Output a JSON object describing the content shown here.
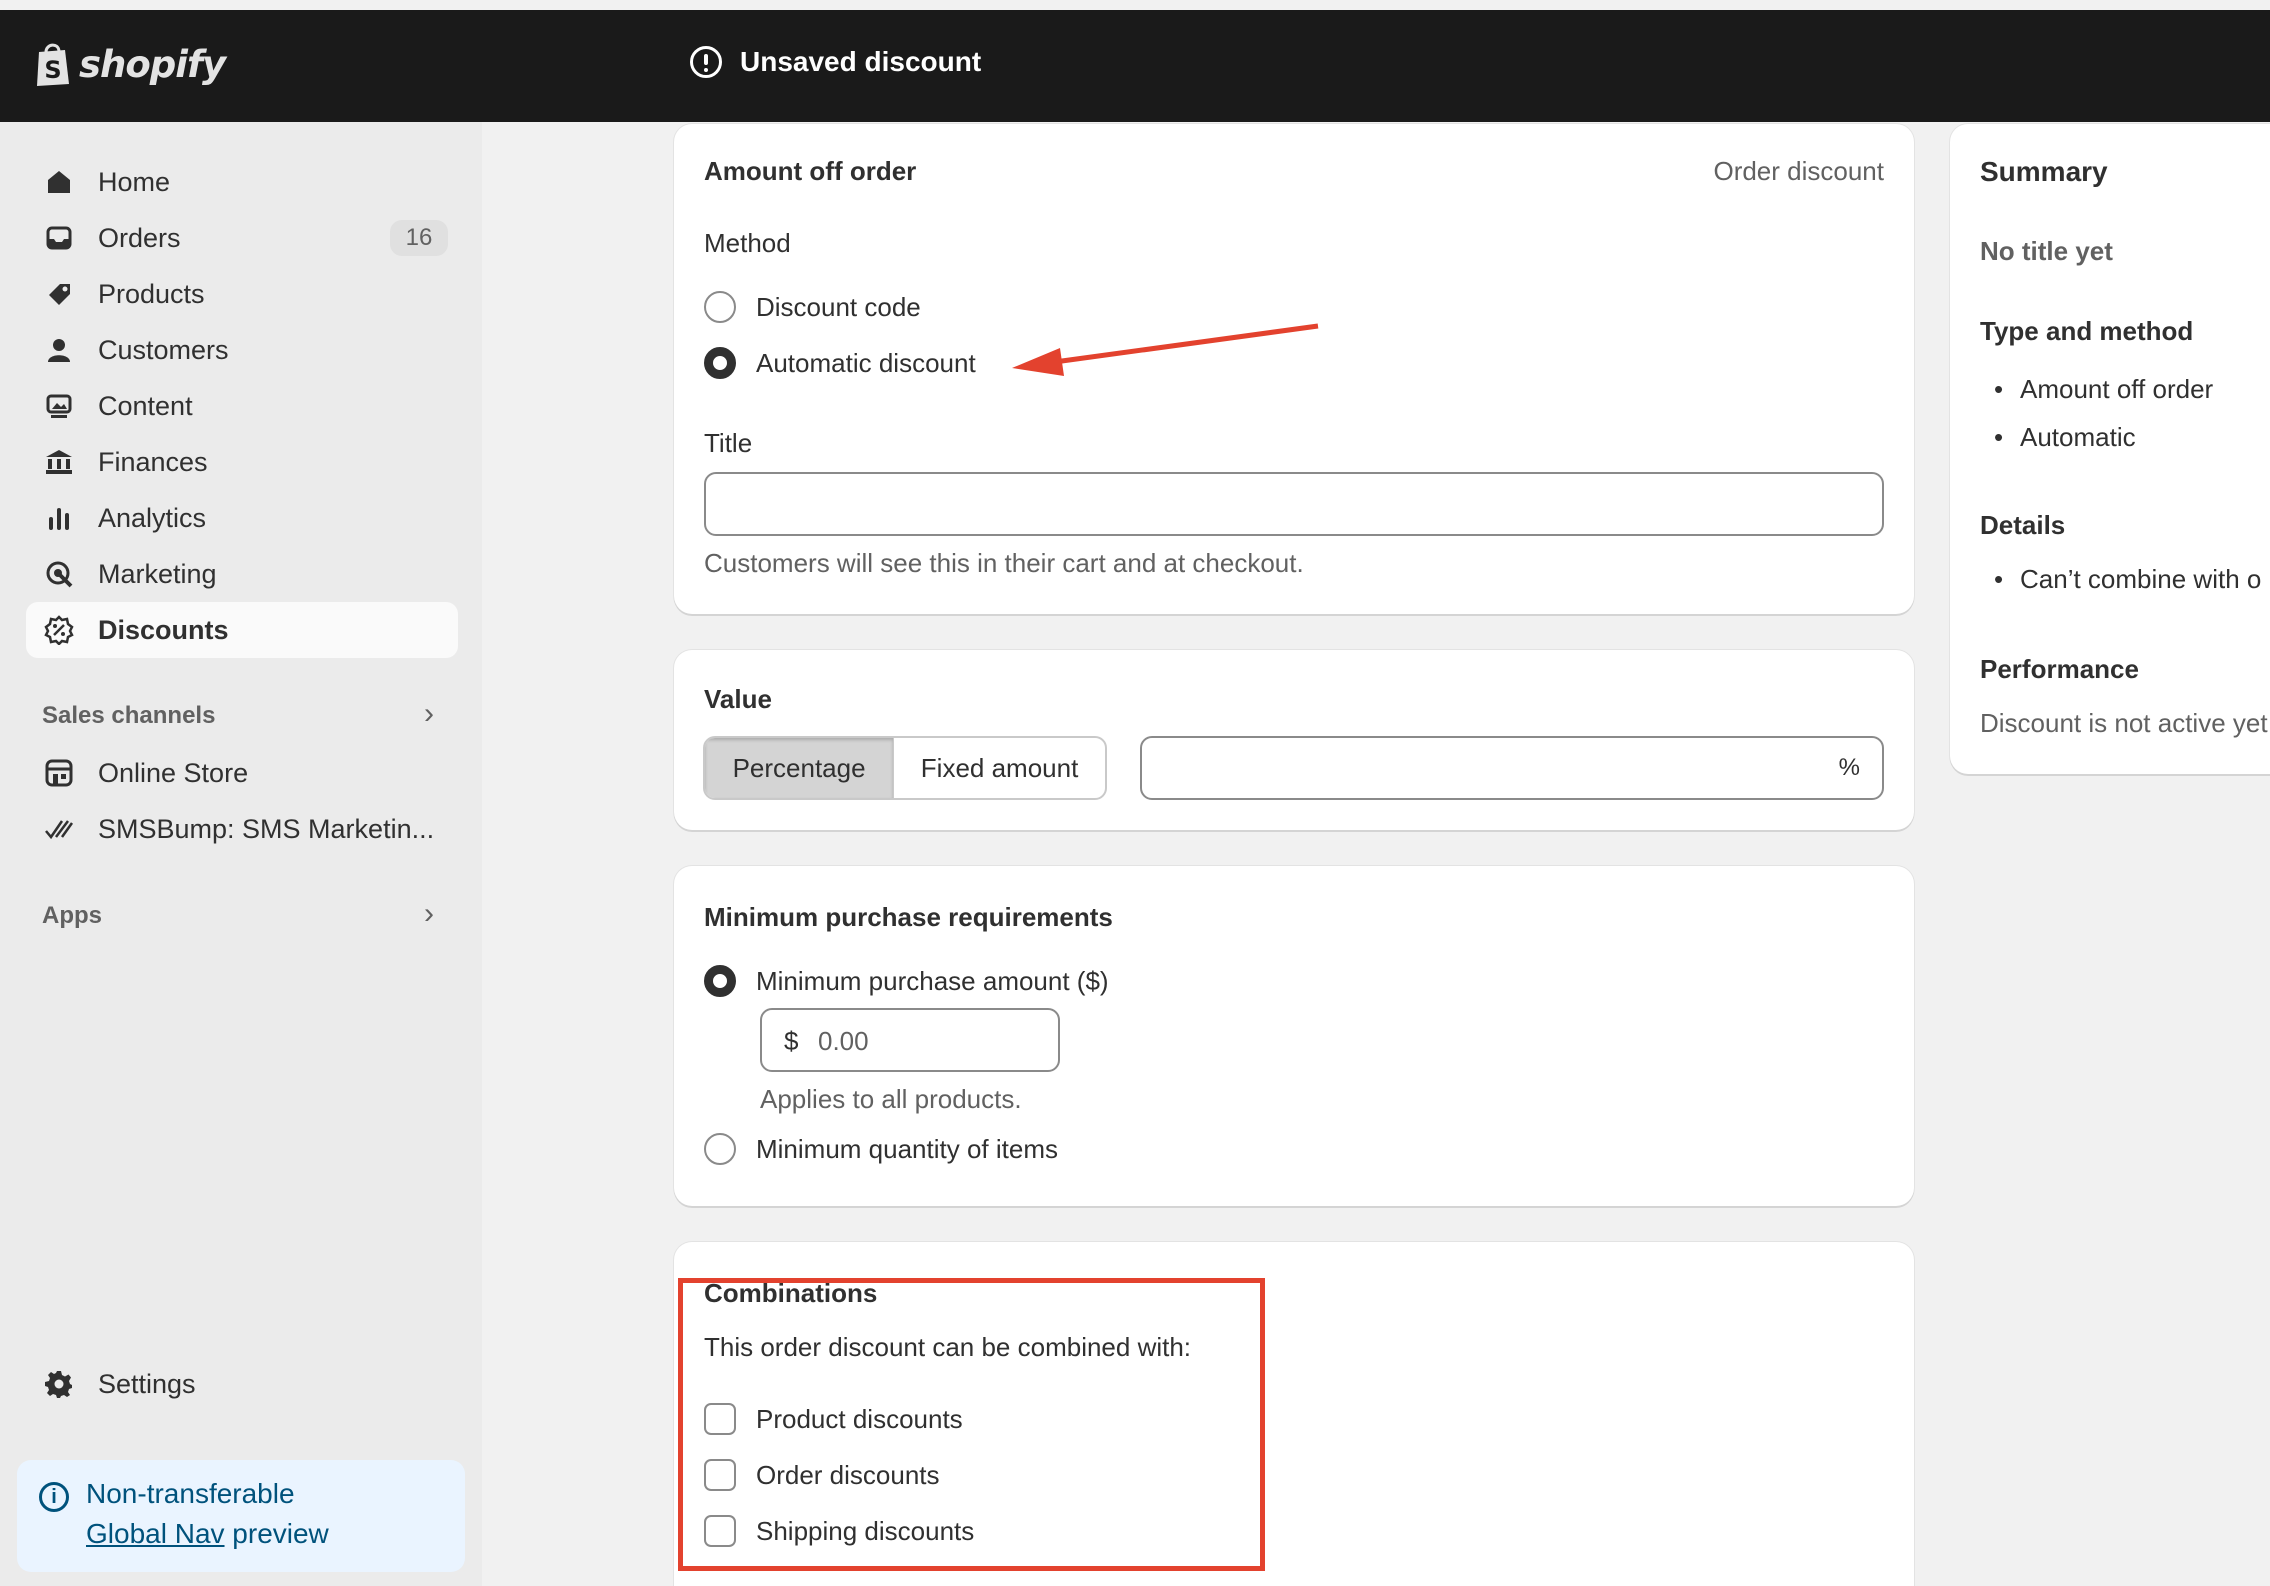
{
  "topbar": {
    "brand": "shopify",
    "status_title": "Unsaved discount"
  },
  "sidebar": {
    "items": [
      {
        "label": "Home",
        "icon": "home-icon"
      },
      {
        "label": "Orders",
        "icon": "inbox-icon",
        "badge": "16"
      },
      {
        "label": "Products",
        "icon": "tag-icon"
      },
      {
        "label": "Customers",
        "icon": "person-icon"
      },
      {
        "label": "Content",
        "icon": "image-icon"
      },
      {
        "label": "Finances",
        "icon": "bank-icon"
      },
      {
        "label": "Analytics",
        "icon": "bar-chart-icon"
      },
      {
        "label": "Marketing",
        "icon": "target-icon"
      },
      {
        "label": "Discounts",
        "icon": "discount-icon",
        "active": true
      }
    ],
    "sales_channels_label": "Sales channels",
    "channels": [
      {
        "label": "Online Store",
        "icon": "store-icon"
      },
      {
        "label": "SMSBump: SMS Marketin...",
        "icon": "smsbump-icon"
      }
    ],
    "apps_label": "Apps",
    "settings_label": "Settings",
    "promo": {
      "line1": "Non-transferable",
      "link": "Global Nav",
      "line2_suffix": "preview"
    }
  },
  "method_card": {
    "title": "Amount off order",
    "type_label": "Order discount",
    "method_label": "Method",
    "options": [
      {
        "label": "Discount code",
        "selected": false
      },
      {
        "label": "Automatic discount",
        "selected": true
      }
    ],
    "title_label": "Title",
    "title_value": "",
    "help": "Customers will see this in their cart and at checkout."
  },
  "value_card": {
    "title": "Value",
    "tabs": [
      {
        "label": "Percentage",
        "selected": true
      },
      {
        "label": "Fixed amount",
        "selected": false
      }
    ],
    "value": "",
    "suffix": "%"
  },
  "minimum_card": {
    "title": "Minimum purchase requirements",
    "option_amount": "Minimum purchase amount ($)",
    "amount_prefix": "$",
    "amount_value": "0.00",
    "amount_help": "Applies to all products.",
    "option_quantity": "Minimum quantity of items"
  },
  "combinations_card": {
    "title": "Combinations",
    "description": "This order discount can be combined with:",
    "options": [
      {
        "label": "Product discounts",
        "checked": false
      },
      {
        "label": "Order discounts",
        "checked": false
      },
      {
        "label": "Shipping discounts",
        "checked": false
      }
    ]
  },
  "summary": {
    "title": "Summary",
    "no_title": "No title yet",
    "type_method_heading": "Type and method",
    "type_method_items": [
      "Amount off order",
      "Automatic"
    ],
    "details_heading": "Details",
    "details_items": [
      "Can’t combine with o"
    ],
    "performance_heading": "Performance",
    "performance_text": "Discount is not active yet"
  },
  "annotations": {
    "highlight_color": "#e3422e"
  }
}
